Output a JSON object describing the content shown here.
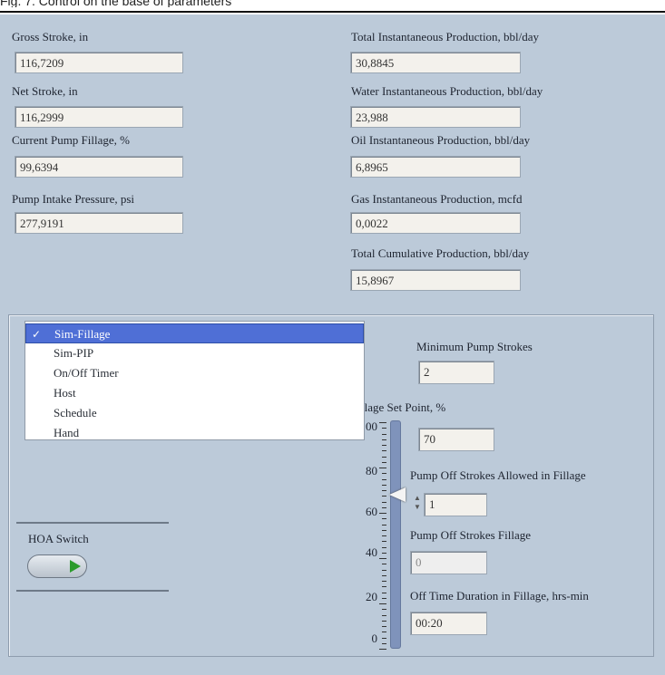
{
  "caption": "Fig. 7. Control on the base of parameters",
  "left_fields": [
    {
      "label": "Gross Stroke, in",
      "value": "116,7209"
    },
    {
      "label": "Net Stroke, in",
      "value": "116,2999"
    },
    {
      "label": "Current Pump Fillage, %",
      "value": "99,6394"
    },
    {
      "label": "Pump Intake Pressure, psi",
      "value": "277,9191"
    }
  ],
  "right_fields": [
    {
      "label": "Total Instantaneous Production, bbl/day",
      "value": "30,8845"
    },
    {
      "label": "Water Instantaneous Production, bbl/day",
      "value": "23,988"
    },
    {
      "label": "Oil Instantaneous Production, bbl/day",
      "value": "6,8965"
    },
    {
      "label": "Gas Instantaneous Production, mcfd",
      "value": "0,0022"
    },
    {
      "label": "Total Cumulative Production, bbl/day",
      "value": "15,8967"
    }
  ],
  "mode_menu": {
    "items": [
      "Sim-Fillage",
      "Sim-PIP",
      "On/Off Timer",
      "Host",
      "Schedule",
      "Hand"
    ],
    "selected": "Sim-Fillage",
    "check_glyph": "✓"
  },
  "hoa": {
    "label": "HOA Switch",
    "state": "on",
    "indicator_color": "#2c9b2c"
  },
  "slider": {
    "label": "llage Set Point, %",
    "tick_labels": [
      "00",
      "80",
      "60",
      "40",
      "20",
      "0"
    ],
    "value_percent": 68
  },
  "controls": {
    "min_strokes_label": "Minimum Pump Strokes",
    "min_strokes_value": "2",
    "set_point_value": "70",
    "off_strokes_label": "Pump Off Strokes Allowed in Fillage",
    "off_strokes_value": "1",
    "off_strokes_fillage_label": "Pump Off Strokes Fillage",
    "off_strokes_fillage_value": "0",
    "off_time_label": "Off Time Duration in Fillage, hrs-min",
    "off_time_value": "00:20"
  },
  "colors": {
    "panel": "#bccad9",
    "selection": "#4f6fd6",
    "slider_track": "#7f93bb"
  }
}
